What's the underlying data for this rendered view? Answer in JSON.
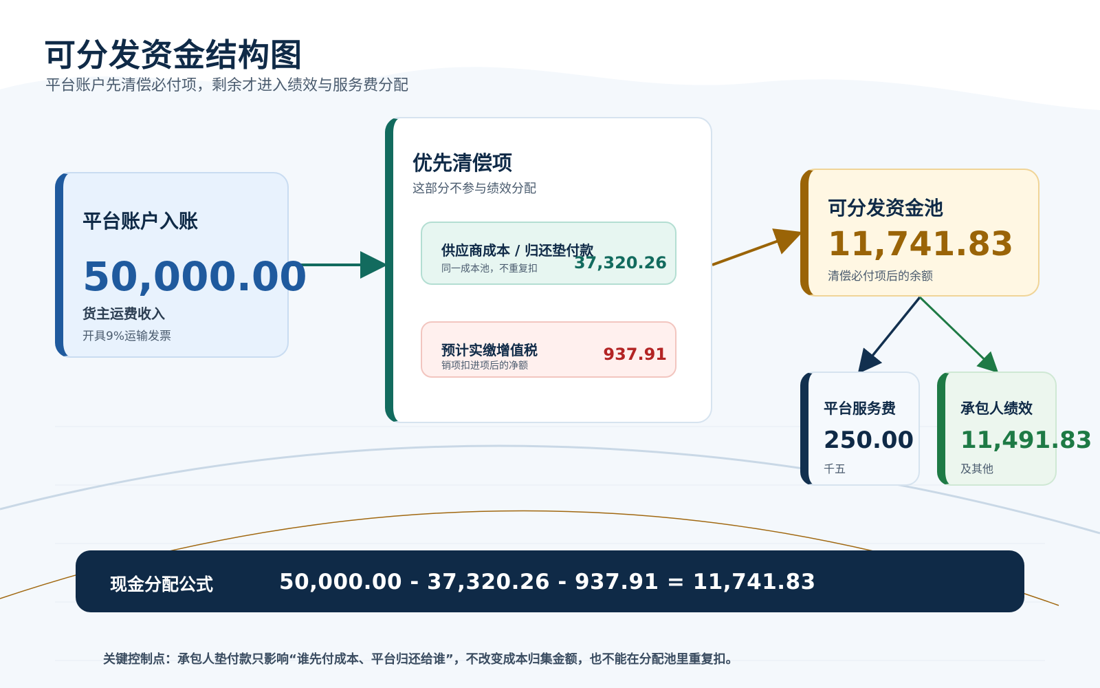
{
  "header": {
    "title": "可分发资金结构图",
    "subtitle": "平台账户先清偿必付项，剩余才进入绩效与服务费分配"
  },
  "income": {
    "heading": "平台账户入账",
    "amount": "50,000.00",
    "label": "货主运费收入",
    "note": "开具9%运输发票"
  },
  "priority": {
    "heading": "优先清偿项",
    "subheading": "这部分不参与绩效分配",
    "items": [
      {
        "title": "供应商成本 / 归还垫付款",
        "note": "同一成本池，不重复扣",
        "value": "37,320.26",
        "color": "#126b5e"
      },
      {
        "title": "预计实缴增值税",
        "note": "销项扣进项后的净额",
        "value": "937.91",
        "color": "#b32424"
      }
    ]
  },
  "pool": {
    "heading": "可分发资金池",
    "amount": "11,741.83",
    "note": "清偿必付项后的余额"
  },
  "service_fee": {
    "heading": "平台服务费",
    "amount": "250.00",
    "note": "千五",
    "color": "#0f2a47"
  },
  "performance": {
    "heading": "承包人绩效",
    "amount": "11,491.83",
    "note": "及其他",
    "color": "#1e7a45"
  },
  "formula": {
    "label": "现金分配公式",
    "expression": "50,000.00 - 37,320.26 - 937.91 = 11,741.83"
  },
  "footnote": "关键控制点：承包人垫付款只影响“谁先付成本、平台归还给谁”，不改变成本归集金额，也不能在分配池里重复扣。",
  "colors": {
    "navy": "#0f2a47",
    "income_accent": "#1f5a9e",
    "priority_accent": "#126b5e",
    "pool_accent": "#9a6407",
    "performance_accent": "#1e7a45",
    "tax_red": "#b32424"
  }
}
